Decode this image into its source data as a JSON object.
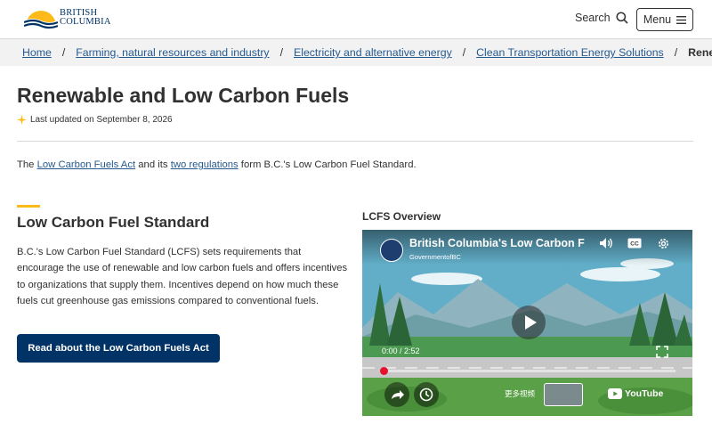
{
  "header": {
    "logo_line1": "BRITISH",
    "logo_line2": "COLUMBIA",
    "search_label": "Search",
    "menu_label": "Menu"
  },
  "breadcrumb": {
    "items": [
      "Home",
      "Farming, natural resources and industry",
      "Electricity and alternative energy",
      "Clean Transportation Energy Solutions"
    ],
    "current": "Renewabl",
    "separator": "/"
  },
  "page": {
    "title": "Renewable and Low Carbon Fuels",
    "updated": "Last updated on September 8, 2026"
  },
  "intro": {
    "prefix": "The ",
    "link1": "Low Carbon Fuels Act",
    "middle": " and its ",
    "link2": "two regulations",
    "suffix": " form B.C.'s Low Carbon Fuel Standard."
  },
  "section": {
    "title": "Low Carbon Fuel Standard",
    "body": "B.C.'s Low Carbon Fuel Standard (LCFS) sets requirements that encourage the use of renewable and low carbon fuels and offers incentives to organizations that supply them. Incentives depend on how much these fuels cut greenhouse gas emissions compared to conventional fuels.",
    "cta_label": "Read about the Low Carbon Fuels Act"
  },
  "video": {
    "heading": "LCFS Overview",
    "title": "British Columbia's Low Carbon F",
    "channel": "GovernmentofBC",
    "time": "0:00 / 2:52",
    "progress": 0,
    "more_label": "更多视频",
    "yt_label": "YouTube"
  },
  "colors": {
    "brand_navy": "#003366",
    "accent_gold": "#fcba19",
    "link_blue": "#255a90",
    "cta_bg": "#013366",
    "yt_red": "#e8112d"
  }
}
